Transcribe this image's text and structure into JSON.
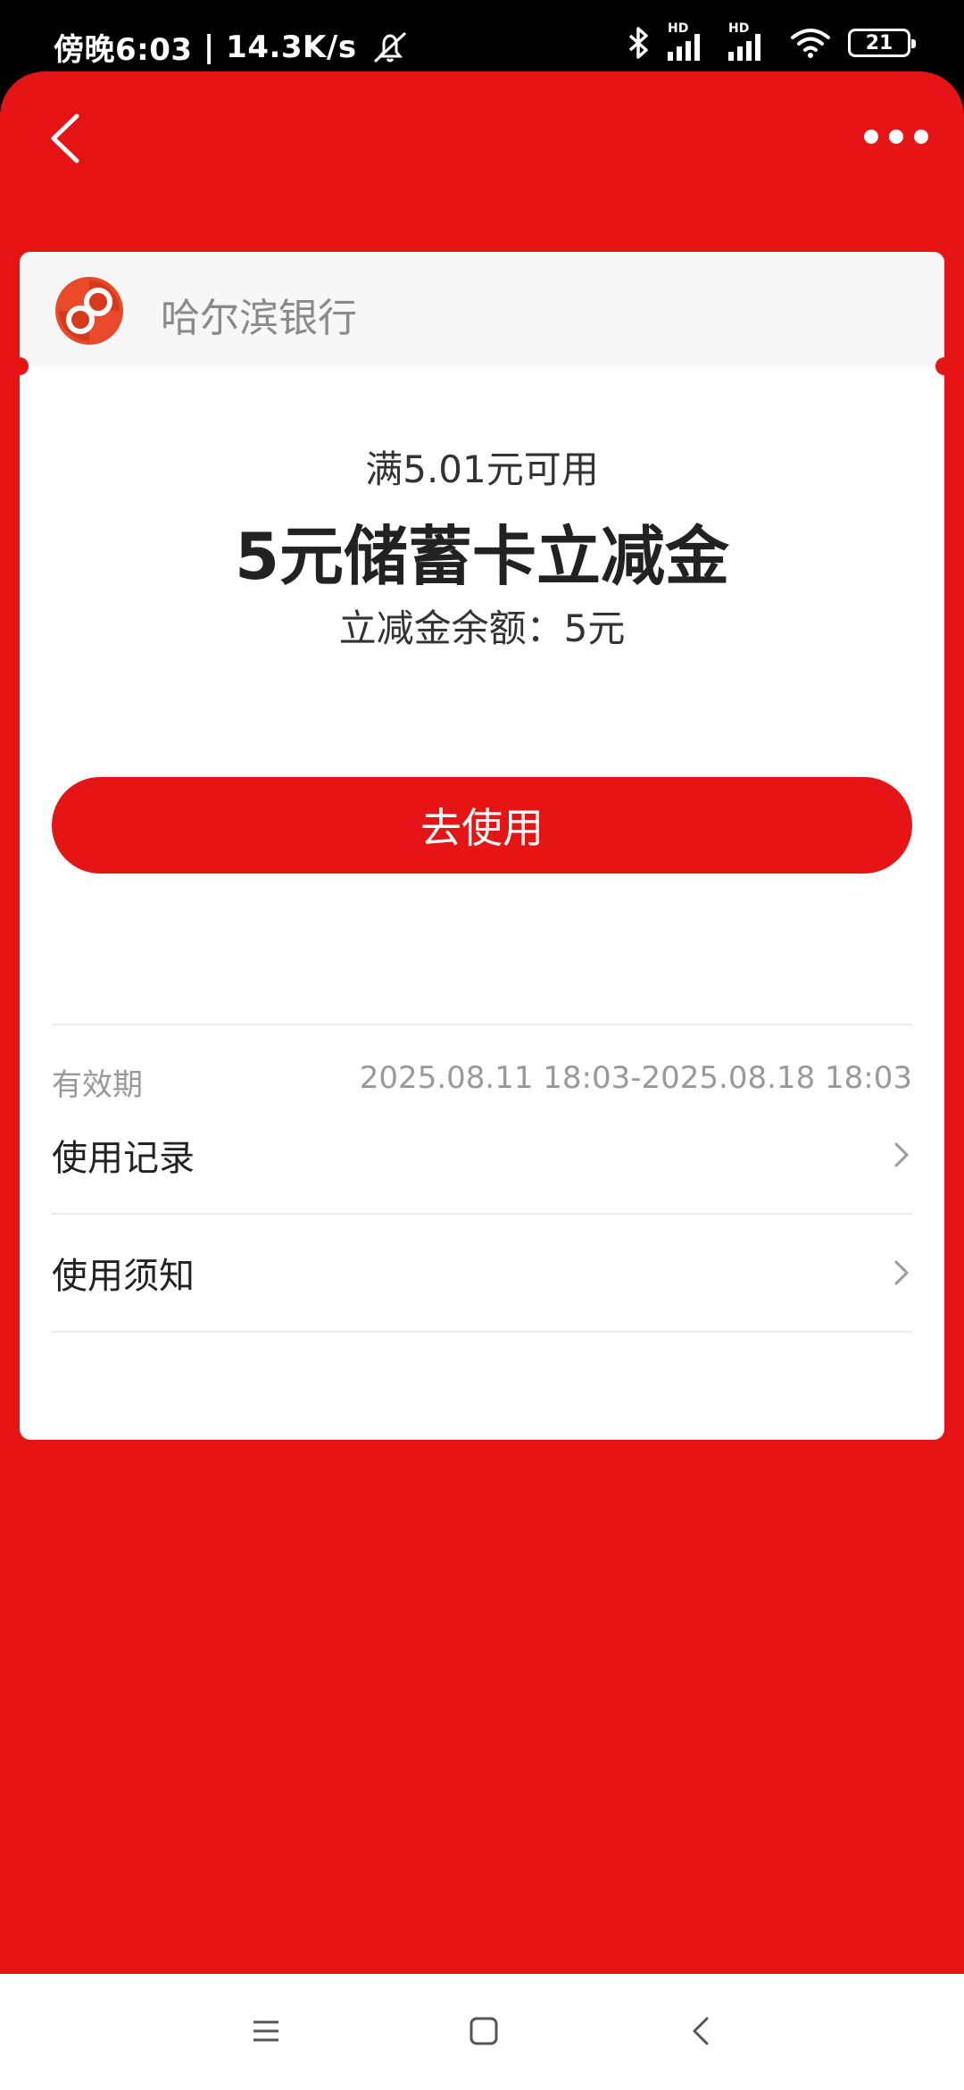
{
  "status_bar": {
    "time": "傍晚6:03",
    "speed": "14.3K/s",
    "sim1_label": "HD",
    "sim2_label": "HD",
    "battery": "21"
  },
  "header": {
    "back_icon": "chevron-left-icon",
    "more_icon": "more-horizontal-icon"
  },
  "card": {
    "bank_name": "哈尔滨银行",
    "condition": "满5.01元可用",
    "title": "5元储蓄卡立减金",
    "balance": "立减金余额：5元",
    "use_button": "去使用",
    "validity_label": "有效期",
    "validity_value": "2025.08.11 18:03-2025.08.18 18:03",
    "rows": [
      {
        "label": "使用记录"
      },
      {
        "label": "使用须知"
      }
    ]
  },
  "colors": {
    "primary_red": "#e61414",
    "card_bg": "#ffffff"
  }
}
